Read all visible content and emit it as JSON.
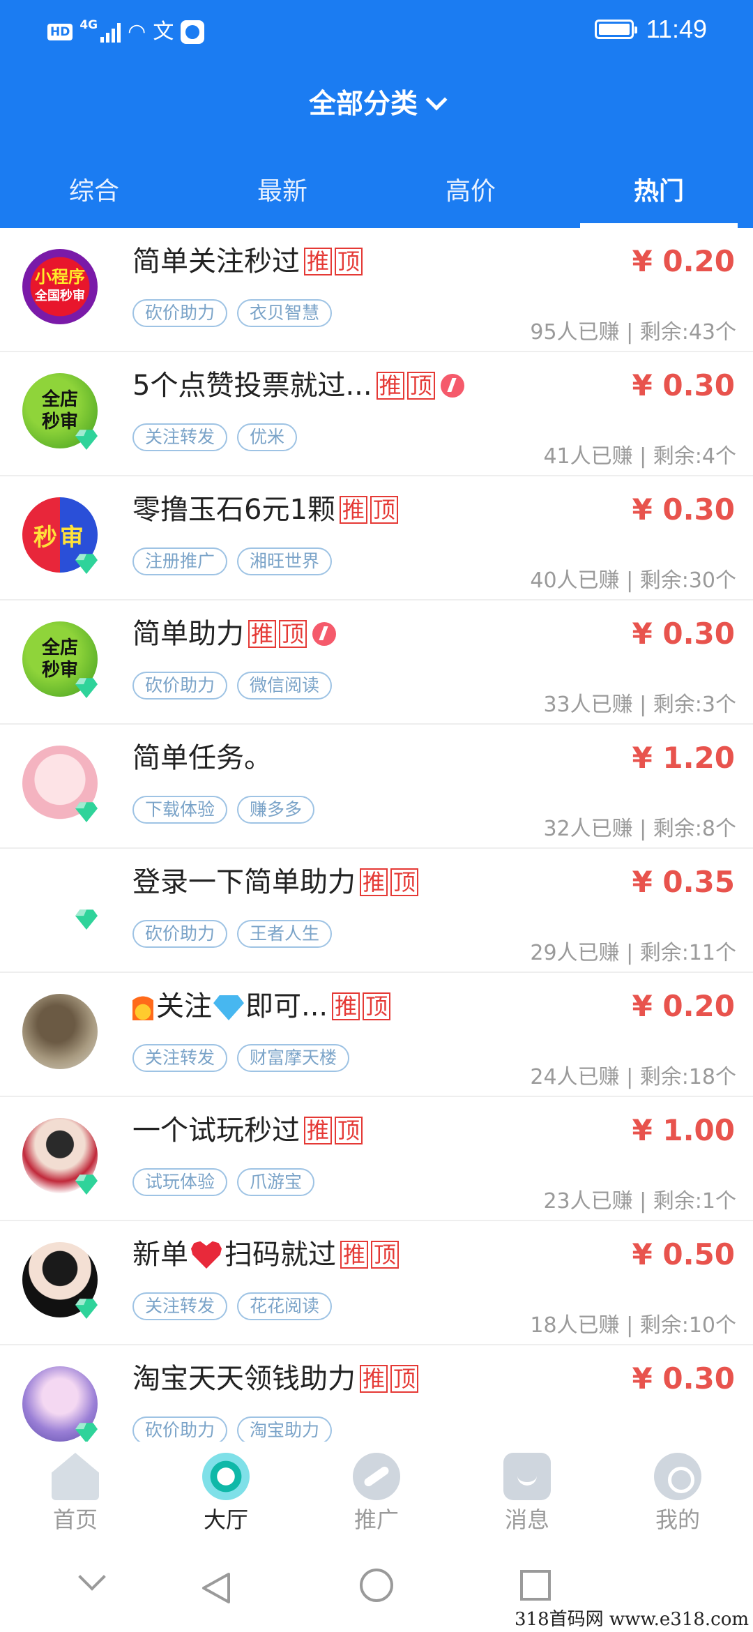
{
  "status_bar": {
    "hd": "HD",
    "network": "4G",
    "time": "11:49"
  },
  "header": {
    "title": "全部分类",
    "tabs": [
      {
        "label": "综合",
        "active": false
      },
      {
        "label": "最新",
        "active": false
      },
      {
        "label": "高价",
        "active": false
      },
      {
        "label": "热门",
        "active": true
      }
    ]
  },
  "list": {
    "badge_labels": [
      "推",
      "顶"
    ],
    "items": [
      {
        "title": "简单关注秒过",
        "price": "¥ 0.20",
        "tags": [
          "砍价助力",
          "衣贝智慧"
        ],
        "stats": "95人已赚 | 剩余:43个",
        "avatar_text": [
          "小程序",
          "全国秒审"
        ]
      },
      {
        "title": "5个点赞投票就过...",
        "price": "¥ 0.30",
        "tags": [
          "关注转发",
          "优米"
        ],
        "stats": "41人已赚 | 剩余:4个",
        "avatar_text": [
          "全店",
          "秒审"
        ]
      },
      {
        "title": "零撸玉石6元1颗",
        "price": "¥ 0.30",
        "tags": [
          "注册推广",
          "湘旺世界"
        ],
        "stats": "40人已赚 | 剩余:30个",
        "avatar_text": [
          "秒审"
        ]
      },
      {
        "title": "简单助力",
        "price": "¥ 0.30",
        "tags": [
          "砍价助力",
          "微信阅读"
        ],
        "stats": "33人已赚 | 剩余:3个",
        "avatar_text": [
          "全店",
          "秒审"
        ]
      },
      {
        "title": "简单任务。",
        "price": "¥ 1.20",
        "tags": [
          "下载体验",
          "赚多多"
        ],
        "stats": "32人已赚 | 剩余:8个"
      },
      {
        "title": "登录一下简单助力",
        "price": "¥ 0.35",
        "tags": [
          "砍价助力",
          "王者人生"
        ],
        "stats": "29人已赚 | 剩余:11个"
      },
      {
        "title_parts": [
          "关注",
          "即可..."
        ],
        "price": "¥ 0.20",
        "tags": [
          "关注转发",
          "财富摩天楼"
        ],
        "stats": "24人已赚 | 剩余:18个"
      },
      {
        "title": "一个试玩秒过",
        "price": "¥ 1.00",
        "tags": [
          "试玩体验",
          "爪游宝"
        ],
        "stats": "23人已赚 | 剩余:1个"
      },
      {
        "title_parts": [
          "新单",
          "扫码就过"
        ],
        "price": "¥ 0.50",
        "tags": [
          "关注转发",
          "花花阅读"
        ],
        "stats": "18人已赚 | 剩余:10个"
      },
      {
        "title": "淘宝天天领钱助力",
        "price": "¥ 0.30",
        "tags": [
          "砍价助力",
          "淘宝助力"
        ],
        "stats": ""
      }
    ]
  },
  "bottom_nav": [
    {
      "label": "首页",
      "icon": "home-icon",
      "active": false
    },
    {
      "label": "大厅",
      "icon": "hall-icon",
      "active": true
    },
    {
      "label": "推广",
      "icon": "promote-icon",
      "active": false
    },
    {
      "label": "消息",
      "icon": "message-icon",
      "active": false
    },
    {
      "label": "我的",
      "icon": "profile-icon",
      "active": false
    }
  ],
  "watermark": "318首码网  www.e318.com"
}
